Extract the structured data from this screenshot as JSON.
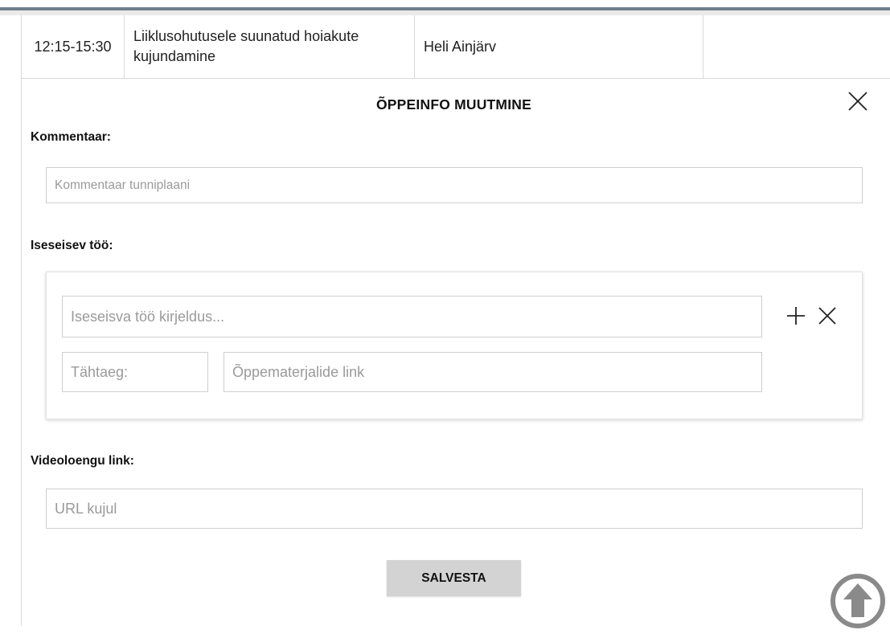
{
  "schedule_row": {
    "time": "12:15-15:30",
    "subject": "Liiklusohutusele suunatud hoiakute kujundamine",
    "teacher": "Heli Ainjärv",
    "extra": ""
  },
  "modal": {
    "title": "ÕPPEINFO MUUTMINE",
    "comment": {
      "label": "Kommentaar:",
      "value": "",
      "placeholder": "Kommentaar tunniplaani"
    },
    "independent_work": {
      "label": "Iseseisev töö:",
      "description": {
        "value": "",
        "placeholder": "Iseseisva töö kirjeldus..."
      },
      "deadline": {
        "value": "",
        "placeholder": "Tähtaeg:"
      },
      "materials_link": {
        "value": "",
        "placeholder": "Õppematerjalide link"
      }
    },
    "video_link": {
      "label": "Videoloengu link:",
      "value": "",
      "placeholder": "URL kujul"
    },
    "save_label": "SALVESTA"
  },
  "icons": {
    "close": "close-icon",
    "add": "plus-icon",
    "remove": "close-icon",
    "scroll_top": "arrow-up-circle-icon"
  },
  "colors": {
    "top_rule": "#6f7f8c",
    "border": "#d9d9d9",
    "button_bg": "#d3d3d3",
    "scroll_icon": "#8a8a8a"
  }
}
